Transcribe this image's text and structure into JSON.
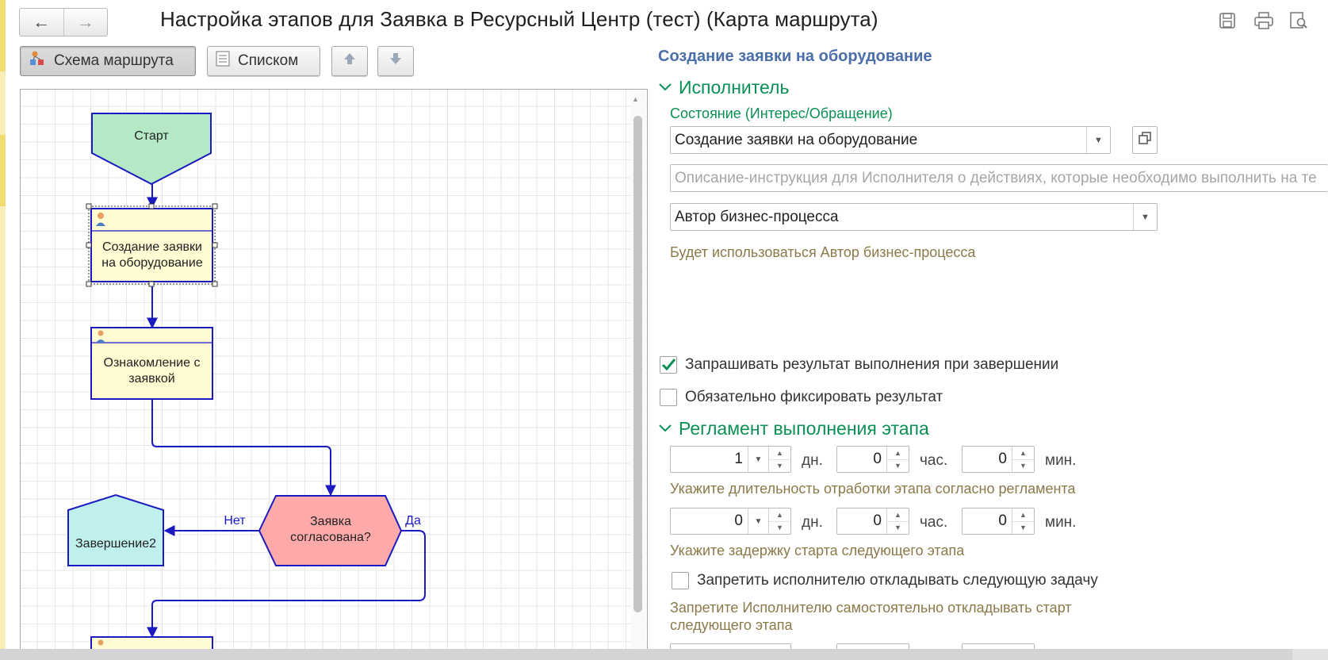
{
  "window": {
    "title": "Настройка этапов для Заявка в Ресурсный Центр (тест) (Карта маршрута)",
    "nav_back_icon": "arrow-left-icon",
    "nav_forward_icon": "arrow-right-icon",
    "tools": [
      "save-icon",
      "print-icon",
      "preview-icon"
    ]
  },
  "toolbar": {
    "route_scheme_label": "Схема маршрута",
    "list_label": "Списком",
    "move_up_icon": "arrow-up-icon",
    "move_down_icon": "arrow-down-icon"
  },
  "diagram": {
    "start_label": "Старт",
    "task1_label_line1": "Создание заявки",
    "task1_label_line2": "на оборудование",
    "task2_label_line1": "Ознакомление с",
    "task2_label_line2": "заявкой",
    "decision_label_line1": "Заявка",
    "decision_label_line2": "согласована?",
    "end_label": "Завершение2",
    "no_label": "Нет",
    "yes_label": "Да"
  },
  "panel": {
    "stage_title": "Создание заявки на оборудование",
    "executor_section": "Исполнитель",
    "state_label": "Состояние (Интерес/Обращение)",
    "state_value": "Создание заявки на оборудование",
    "description_placeholder": "Описание-инструкция для Исполнителя о действиях, которые необходимо выполнить на те",
    "executor_value": "Автор бизнес-процесса",
    "executor_hint": "Будет использоваться Автор бизнес-процесса",
    "request_result_label": "Запрашивать результат выполнения при завершении",
    "request_result_checked": true,
    "fix_result_label": "Обязательно фиксировать результат",
    "fix_result_checked": false,
    "regulation_section": "Регламент выполнения этапа",
    "duration": {
      "days": "1",
      "hours": "0",
      "minutes": "0"
    },
    "duration_hint": "Укажите длительность отработки этапа согласно регламента",
    "delay": {
      "days": "0",
      "hours": "0",
      "minutes": "0"
    },
    "delay_hint": "Укажите задержку старта следующего этапа",
    "unit_days": "дн.",
    "unit_hours": "час.",
    "unit_minutes": "мин.",
    "forbid_postpone_label": "Запретить исполнителю откладывать следующую задачу",
    "forbid_postpone_checked": false,
    "forbid_hint_line1": "Запретите Исполнителю самостоятельно откладывать старт",
    "forbid_hint_line2": "следующего этапа"
  },
  "colors": {
    "accent_green": "#0a8f54",
    "stage_title_blue": "#4a6ea8",
    "hint_text": "#8a7a4a",
    "start_fill": "#b5e9c6",
    "task_fill": "#fffbd2",
    "decision_fill": "#ffaaaa",
    "end_fill": "#bff0ee",
    "connector": "#1a1ac0"
  }
}
